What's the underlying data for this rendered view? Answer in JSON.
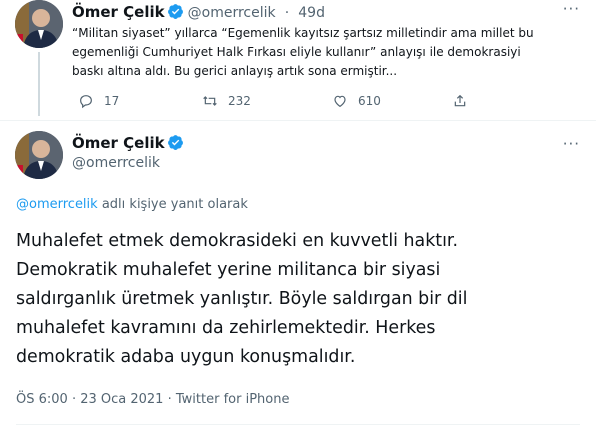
{
  "parent_tweet": {
    "author_name": "Ömer Çelik",
    "handle": "@omerrcelik",
    "separator": "·",
    "time_ago": "49d",
    "more": "···",
    "text_lines": [
      "“Militan siyaset” yıllarca “Egemenlik kayıtsız şartsız milletindir ama millet bu",
      "egemenliği Cumhuriyet Halk Fırkası eliyle kullanır” anlayışı ile demokrasiyi",
      "baskı altına aldı. Bu gerici anlayış artık sona ermiştir..."
    ],
    "actions": {
      "reply_count": "17",
      "retweet_count": "232",
      "like_count": "610"
    }
  },
  "main_tweet": {
    "author_name": "Ömer Çelik",
    "handle": "@omerrcelik",
    "more": "···",
    "reply_mention": "@omerrcelik",
    "reply_suffix": " adlı kişiye yanıt olarak",
    "text_lines": [
      "Muhalefet etmek demokrasideki en kuvvetli haktır.",
      "Demokratik muhalefet yerine militanca bir siyasi",
      "saldırganlık üretmek yanlıştır. Böyle saldırgan bir dil",
      "muhalefet kavramını da zehirlemektedir. Herkes",
      "demokratik adaba uygun konuşmalıdır."
    ],
    "time": "ÖS 6:00",
    "separator": " · ",
    "date": "23 Oca 2021",
    "source": "Twitter for iPhone"
  },
  "icons": {
    "verified": "verified-badge-icon",
    "reply": "reply-icon",
    "retweet": "retweet-icon",
    "like": "heart-icon",
    "share": "share-icon"
  },
  "colors": {
    "text": "#0f1419",
    "muted": "#536471",
    "accent": "#1d9bf0",
    "divider": "#eff3f4"
  }
}
